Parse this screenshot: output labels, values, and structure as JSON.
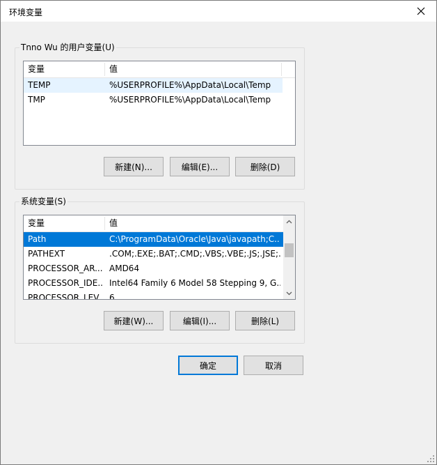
{
  "window": {
    "title": "环境变量"
  },
  "user_vars": {
    "label": "Tnno Wu 的用户变量(U)",
    "columns": [
      "变量",
      "值"
    ],
    "rows": [
      {
        "name": "TEMP",
        "value": "%USERPROFILE%\\AppData\\Local\\Temp"
      },
      {
        "name": "TMP",
        "value": "%USERPROFILE%\\AppData\\Local\\Temp"
      }
    ],
    "buttons": {
      "new": "新建(N)...",
      "edit": "编辑(E)...",
      "delete": "删除(D)"
    }
  },
  "system_vars": {
    "label": "系统变量(S)",
    "columns": [
      "变量",
      "值"
    ],
    "rows": [
      {
        "name": "Path",
        "value": "C:\\ProgramData\\Oracle\\Java\\javapath;C..."
      },
      {
        "name": "PATHEXT",
        "value": ".COM;.EXE;.BAT;.CMD;.VBS;.VBE;.JS;.JSE;..."
      },
      {
        "name": "PROCESSOR_AR...",
        "value": "AMD64"
      },
      {
        "name": "PROCESSOR_IDE...",
        "value": "Intel64 Family 6 Model 58 Stepping 9, G..."
      },
      {
        "name": "PROCESSOR_LEV...",
        "value": "6"
      }
    ],
    "buttons": {
      "new": "新建(W)...",
      "edit": "编辑(I)...",
      "delete": "删除(L)"
    }
  },
  "footer": {
    "ok": "确定",
    "cancel": "取消"
  },
  "colors": {
    "selection": "#0078d7",
    "hover_row": "#e5f3ff",
    "accent": "#0078d7"
  }
}
